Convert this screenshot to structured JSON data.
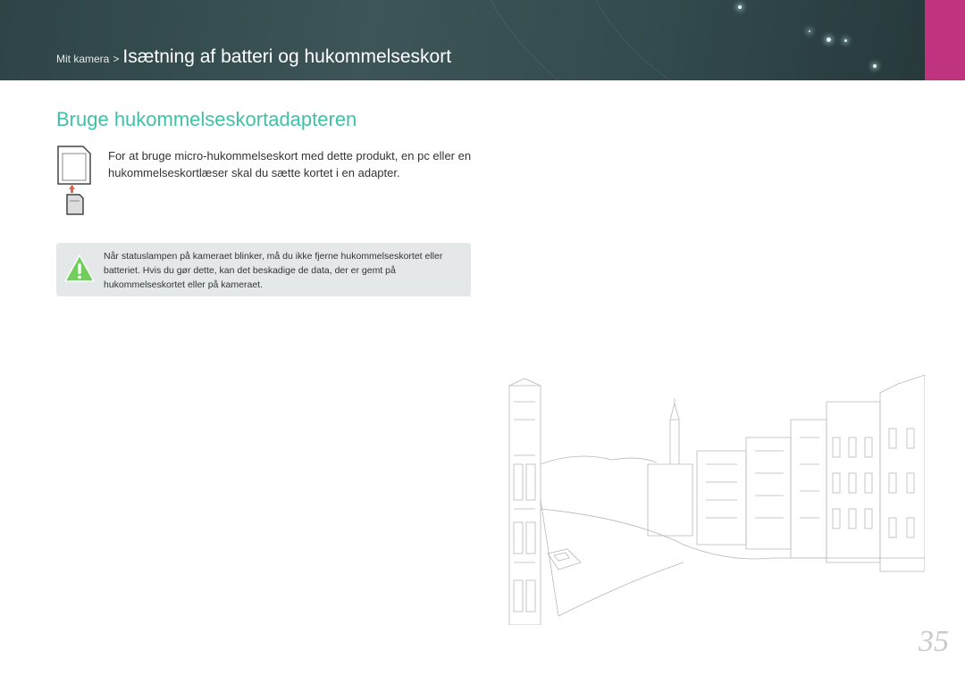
{
  "header": {
    "breadcrumb_parent": "Mit kamera",
    "breadcrumb_separator": ">",
    "breadcrumb_current": "Isætning af batteri og hukommelseskort",
    "background_color": "#3d5558",
    "accent_color": "#c0347f"
  },
  "section": {
    "title": "Bruge hukommelseskortadapteren",
    "title_color": "#3fc1a7",
    "intro_text": "For at bruge micro-hukommelseskort med dette produkt, en pc eller en hukommelseskortlæser skal du sætte kortet i en adapter.",
    "intro_icon": "memory-card-adapter-icon"
  },
  "note": {
    "icon": "warning-icon",
    "text": "Når statuslampen på kameraet blinker, må du ikke fjerne hukommelseskortet eller batteriet. Hvis du gør dette, kan det beskadige de data, der er gemt på hukommelseskortet eller på kameraet.",
    "icon_color": "#6fcf5a"
  },
  "illustration": {
    "icon": "city-canal-sketch"
  },
  "page": {
    "number": "35"
  }
}
